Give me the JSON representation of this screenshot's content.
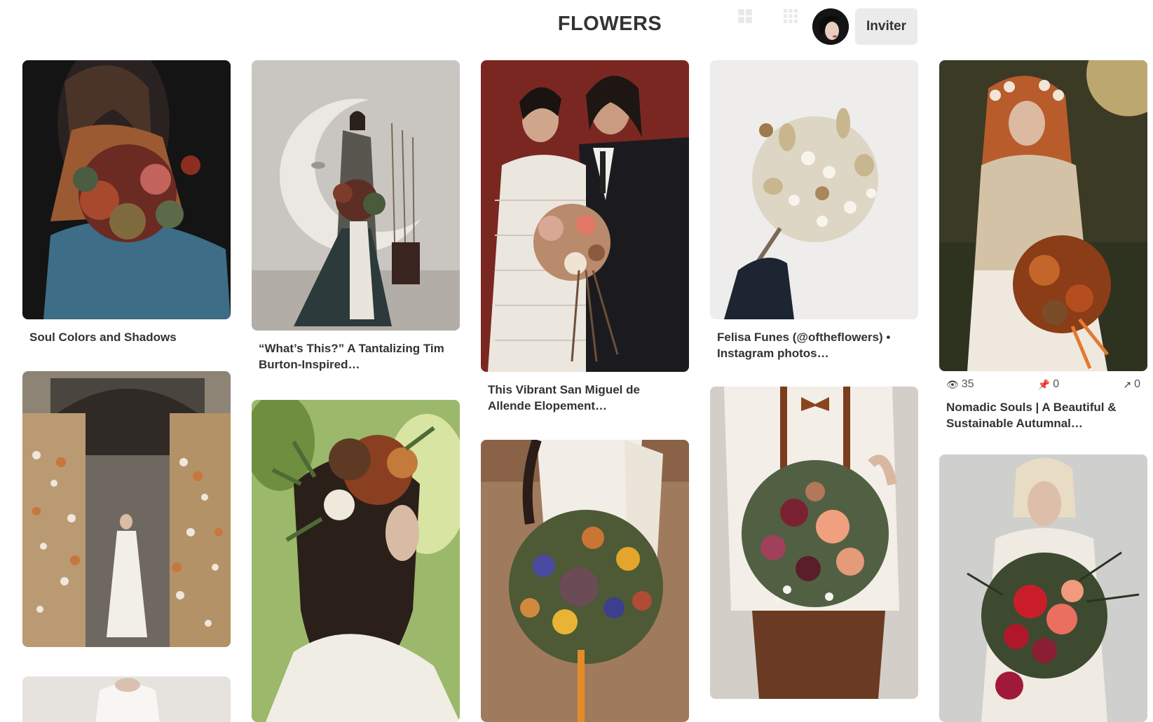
{
  "board": {
    "title": "FLOWERS",
    "invite_label": "Inviter",
    "avatar_label": "Profile",
    "icons": [
      "grid-view-icon",
      "grid-compact-icon"
    ]
  },
  "pins": [
    {
      "caption": "Soul Colors and Shadows",
      "image": "woman-blue-dress-bouquet-image"
    },
    {
      "caption": "“What’s This?” A Tantalizing Tim Burton-Inspired…",
      "image": "moon-backdrop-bride-image"
    },
    {
      "caption": "This Vibrant San Miguel de Allende Elopement…",
      "image": "couple-red-wall-image"
    },
    {
      "caption": "Felisa Funes (@oftheflowers) • Instagram photos…",
      "image": "dried-flower-bouquet-image"
    },
    {
      "caption": "Nomadic Souls | A Beautiful & Sustainable Autumnal…",
      "image": "flower-crown-bride-image",
      "stats": {
        "views": "35",
        "saves": "0",
        "shares": "0"
      }
    },
    {
      "image": "floral-arch-bride-image"
    },
    {
      "image": "flower-crown-profile-image"
    },
    {
      "image": "wildflower-bouquet-image"
    },
    {
      "image": "groom-suspenders-bouquet-image"
    },
    {
      "image": "bride-red-bouquet-image"
    },
    {
      "image": "partial-pin-image"
    }
  ]
}
